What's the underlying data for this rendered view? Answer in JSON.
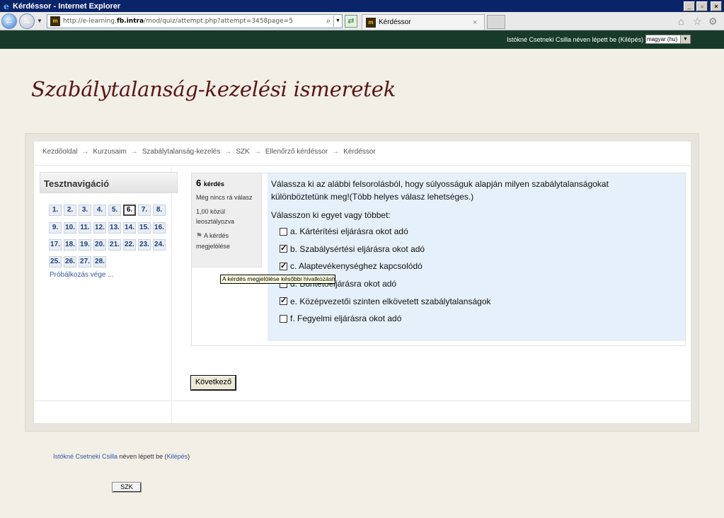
{
  "window": {
    "title": "Kérdéssor - Internet Explorer",
    "controls": [
      "_",
      "▫",
      "×"
    ]
  },
  "browser": {
    "url_prefix": "http://e-learning.",
    "url_host": "fb.intra",
    "url_path": "/mod/quiz/attempt.php?attempt=3458page=5",
    "tab_label": "Kérdéssor",
    "tab_close": "×"
  },
  "header": {
    "login_text": "Istókné Csetneki Csilla néven lépett be (Kilépés)",
    "language": "magyar (hu)"
  },
  "site_title": "Szabálytalanság-kezelési ismeretek",
  "breadcrumb": [
    "Kezdőoldal",
    "Kurzusaim",
    "Szabálytalanság-kezelés",
    "SZK",
    "Ellenőrző kérdéssor",
    "Kérdéssor"
  ],
  "quiz_nav": {
    "title": "Tesztnavigáció",
    "questions": [
      "1.",
      "2.",
      "3.",
      "4.",
      "5.",
      "6.",
      "7.",
      "8.",
      "9.",
      "10.",
      "11.",
      "12.",
      "13.",
      "14.",
      "15.",
      "16.",
      "17.",
      "18.",
      "19.",
      "20.",
      "21.",
      "22.",
      "23.",
      "24.",
      "25.",
      "26.",
      "27.",
      "28."
    ],
    "current": 6,
    "finish_label": "Próbálkozás vége ..."
  },
  "question": {
    "number": "6",
    "number_label": "kérdés",
    "state": "Még nincs rá válasz",
    "grade": "1,00 közül leosztályozva",
    "flag_label": "A kérdés megjelölése",
    "text": "Válassza ki az alábbi felsorolásból, hogy súlyosságuk alapján milyen szabálytalanságokat különböztetünk meg!(Több helyes válasz lehetséges.)",
    "prompt": "Válasszon ki egyet vagy többet:",
    "answers": [
      {
        "label": "a. Kártérítési eljárásra okot adó",
        "checked": false
      },
      {
        "label": "b. Szabálysértési eljárásra okot adó",
        "checked": true
      },
      {
        "label": "c. Alaptevékenységhez kapcsolódó",
        "checked": true
      },
      {
        "label": "d. Büntetőeljárásra okot adó",
        "checked": false
      },
      {
        "label": "e. Középvezetői szinten elkövetett szabálytalanságok",
        "checked": true
      },
      {
        "label": "f. Fegyelmi eljárásra okot adó",
        "checked": false
      }
    ],
    "tooltip": "A kérdés megjelölése későbbi hivatkozáshoz"
  },
  "next_button": "Következő",
  "footer": {
    "user_name": "Istókné Csetneki Csilla",
    "mid_text": " néven lépett be (",
    "logout": "Kilépés",
    "end_text": ")",
    "szk_button": "SZK"
  }
}
